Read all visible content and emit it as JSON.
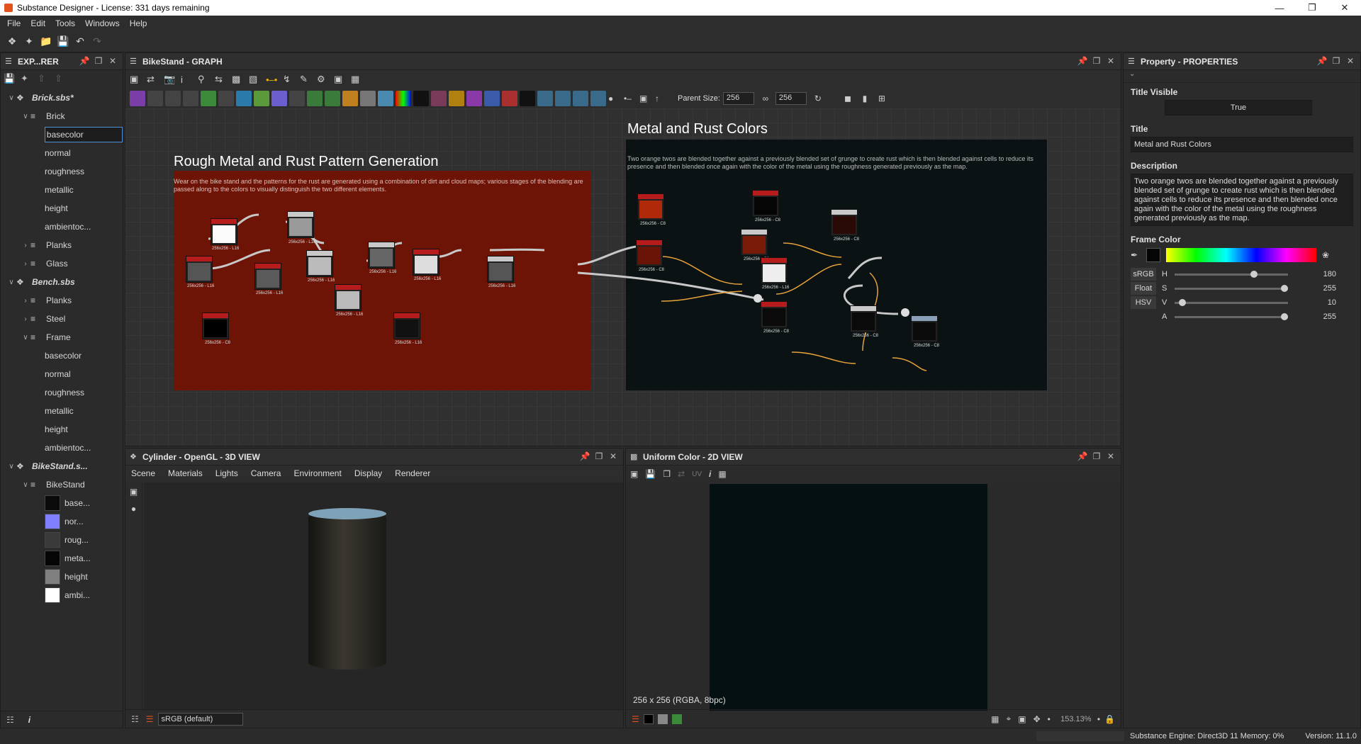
{
  "window": {
    "title": "Substance Designer - License: 331 days remaining"
  },
  "menu": [
    "File",
    "Edit",
    "Tools",
    "Windows",
    "Help"
  ],
  "explorer": {
    "title": "EXP...RER",
    "tree": [
      {
        "label": "Brick.sbs*",
        "level": 0,
        "kind": "package"
      },
      {
        "label": "Brick",
        "level": 1,
        "kind": "graph"
      },
      {
        "label": "basecolor",
        "level": 2,
        "kind": "output",
        "selected": true
      },
      {
        "label": "normal",
        "level": 2,
        "kind": "output"
      },
      {
        "label": "roughness",
        "level": 2,
        "kind": "output"
      },
      {
        "label": "metallic",
        "level": 2,
        "kind": "output"
      },
      {
        "label": "height",
        "level": 2,
        "kind": "output"
      },
      {
        "label": "ambientoc...",
        "level": 2,
        "kind": "output"
      },
      {
        "label": "Planks",
        "level": 1,
        "kind": "graph-collapsed"
      },
      {
        "label": "Glass",
        "level": 1,
        "kind": "graph-collapsed"
      },
      {
        "label": "Bench.sbs",
        "level": 0,
        "kind": "package"
      },
      {
        "label": "Planks",
        "level": 1,
        "kind": "graph-collapsed"
      },
      {
        "label": "Steel",
        "level": 1,
        "kind": "graph-collapsed"
      },
      {
        "label": "Frame",
        "level": 1,
        "kind": "graph"
      },
      {
        "label": "basecolor",
        "level": 2,
        "kind": "output"
      },
      {
        "label": "normal",
        "level": 2,
        "kind": "output"
      },
      {
        "label": "roughness",
        "level": 2,
        "kind": "output"
      },
      {
        "label": "metallic",
        "level": 2,
        "kind": "output"
      },
      {
        "label": "height",
        "level": 2,
        "kind": "output"
      },
      {
        "label": "ambientoc...",
        "level": 2,
        "kind": "output"
      },
      {
        "label": "BikeStand.s...",
        "level": 0,
        "kind": "package"
      },
      {
        "label": "BikeStand",
        "level": 1,
        "kind": "graph"
      },
      {
        "label": "base...",
        "level": 2,
        "kind": "swatch",
        "color": "#0a0a0a"
      },
      {
        "label": "nor...",
        "level": 2,
        "kind": "swatch",
        "color": "#8080ff"
      },
      {
        "label": "roug...",
        "level": 2,
        "kind": "swatch",
        "color": "#3a3a3a"
      },
      {
        "label": "meta...",
        "level": 2,
        "kind": "swatch",
        "color": "#050505"
      },
      {
        "label": "height",
        "level": 2,
        "kind": "swatch",
        "color": "#808080"
      },
      {
        "label": "ambi...",
        "level": 2,
        "kind": "swatch",
        "color": "#ffffff"
      }
    ]
  },
  "graph": {
    "title": "BikeStand - GRAPH",
    "parent_size_label": "Parent Size:",
    "size_w": "256",
    "size_h": "256",
    "frame1": {
      "title": "Rough Metal and Rust Pattern Generation",
      "desc": "Wear on the bike stand and the patterns for the rust are generated using a combination of dirt and cloud maps; various stages of the blending are passed along to the colors to visually distinguish the two different elements.",
      "color": "#6e1407"
    },
    "frame2": {
      "title": "Metal and Rust Colors",
      "desc": "Two orange twos are blended together against a previously blended set of grunge to create rust which is then blended against cells to reduce its presence and then blended once again with the color of the metal using the roughness generated previously as the map.",
      "color": "#0a1214"
    },
    "node_size_16": "256x256 - L16",
    "node_size_c8": "256x256 - C8"
  },
  "properties": {
    "title": "Property - PROPERTIES",
    "title_visible_label": "Title Visible",
    "title_visible_value": "True",
    "title_label": "Title",
    "title_value": "Metal and Rust Colors",
    "description_label": "Description",
    "description_value": "Two orange twos are blended together against a previously blended set of grunge to create rust which is then blended against cells to reduce its presence and then blended once again with the color of the metal using the roughness generated previously as the map.",
    "frame_color_label": "Frame Color",
    "modes": [
      "sRGB",
      "Float",
      "HSV"
    ],
    "channels": [
      {
        "name": "H",
        "value": "180",
        "fraction": 0.71
      },
      {
        "name": "S",
        "value": "255",
        "fraction": 1.0
      },
      {
        "name": "V",
        "value": "10",
        "fraction": 0.04
      },
      {
        "name": "A",
        "value": "255",
        "fraction": 1.0
      }
    ]
  },
  "view3d": {
    "title": "Cylinder - OpenGL - 3D VIEW",
    "menu": [
      "Scene",
      "Materials",
      "Lights",
      "Camera",
      "Environment",
      "Display",
      "Renderer"
    ],
    "colorspace": "sRGB (default)"
  },
  "view2d": {
    "title": "Uniform Color - 2D VIEW",
    "uv_label": "UV",
    "info": "256 x 256 (RGBA, 8bpc)",
    "zoom": "153.13%"
  },
  "status": {
    "engine": "Substance Engine: Direct3D 11  Memory: 0%",
    "version": "Version: 11.1.0"
  }
}
